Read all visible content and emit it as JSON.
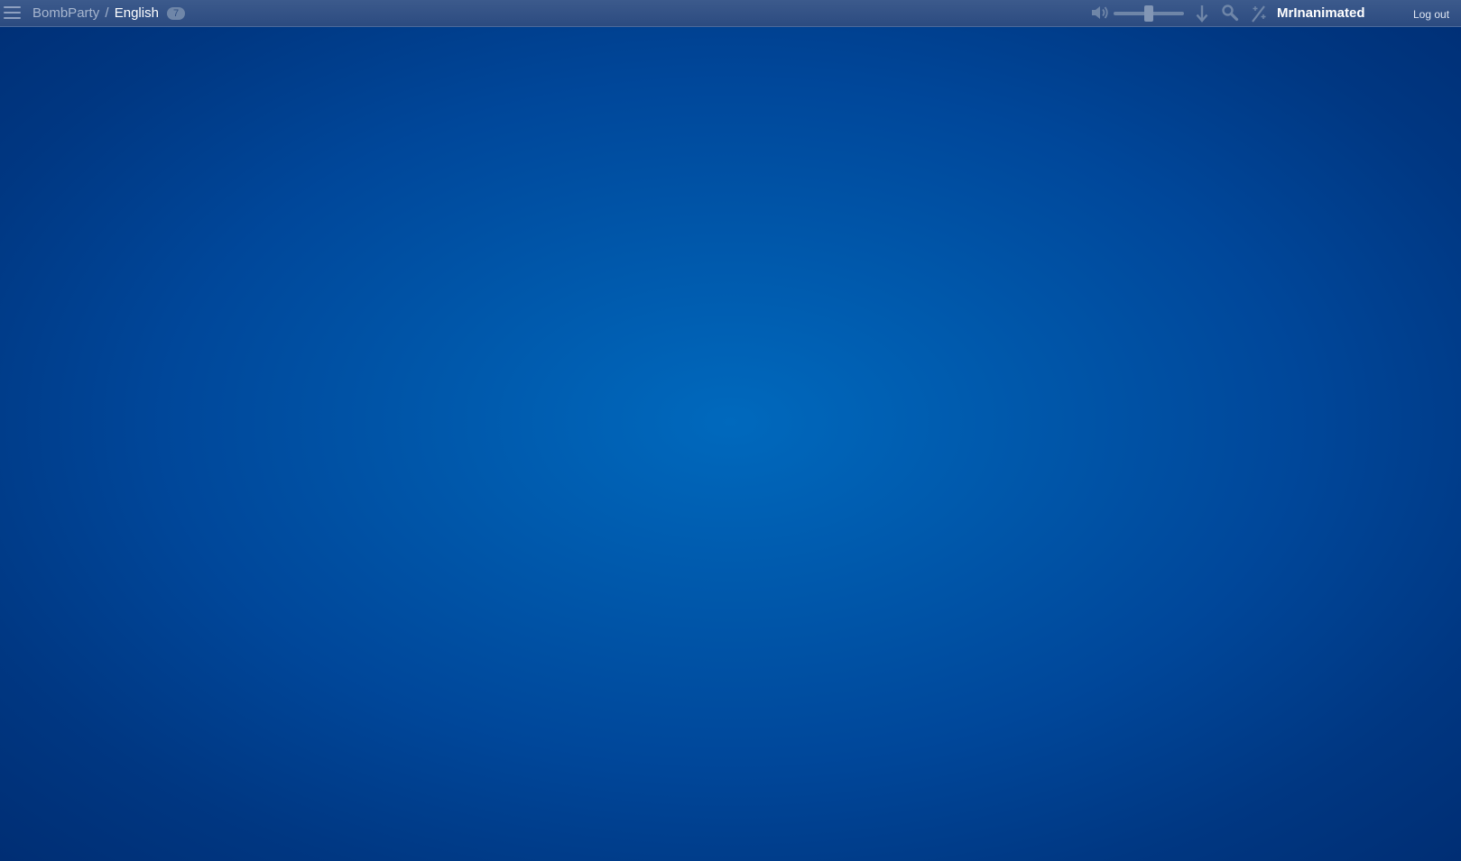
{
  "header": {
    "breadcrumb": {
      "app_name": "BombParty",
      "separator": "/",
      "room_name": "English",
      "player_count": "7"
    },
    "volume": {
      "level": 0.5
    },
    "icons": [
      "menu-icon",
      "volume-icon",
      "down-arrow-icon",
      "search-icon",
      "magic-wand-icon"
    ],
    "user": {
      "username": "MrInanimated",
      "logout_label": "Log out"
    }
  },
  "colors": {
    "topbar": "#2c4b80",
    "background_center": "#0069bd",
    "background_edge": "#002e74",
    "icon": "#6f86a8"
  }
}
